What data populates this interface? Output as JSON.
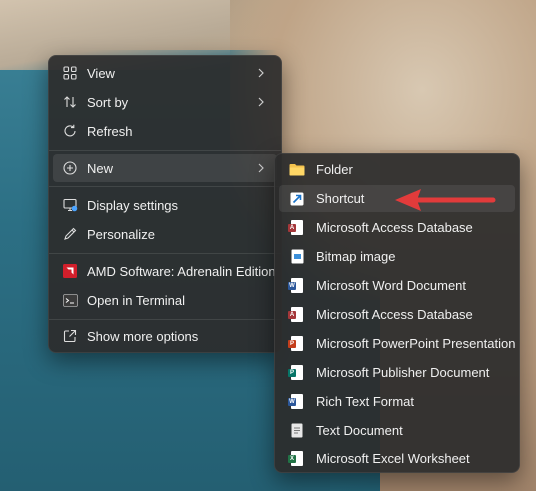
{
  "main_menu": {
    "items": [
      {
        "label": "View",
        "icon": "grid-icon",
        "submenu": true
      },
      {
        "label": "Sort by",
        "icon": "sort-icon",
        "submenu": true
      },
      {
        "label": "Refresh",
        "icon": "refresh-icon",
        "submenu": false
      },
      {
        "label": "New",
        "icon": "add-circle-icon",
        "submenu": true
      },
      {
        "label": "Display settings",
        "icon": "display-icon",
        "submenu": false
      },
      {
        "label": "Personalize",
        "icon": "pen-icon",
        "submenu": false
      },
      {
        "label": "AMD Software: Adrenalin Edition",
        "icon": "amd-icon",
        "submenu": false
      },
      {
        "label": "Open in Terminal",
        "icon": "terminal-icon",
        "submenu": false
      },
      {
        "label": "Show more options",
        "icon": "share-icon",
        "submenu": false
      }
    ]
  },
  "new_submenu": {
    "items": [
      {
        "label": "Folder",
        "icon": "folder-icon"
      },
      {
        "label": "Shortcut",
        "icon": "shortcut-icon"
      },
      {
        "label": "Microsoft Access Database",
        "icon": "access-icon"
      },
      {
        "label": "Bitmap image",
        "icon": "bitmap-icon"
      },
      {
        "label": "Microsoft Word Document",
        "icon": "word-icon"
      },
      {
        "label": "Microsoft Access Database",
        "icon": "access-icon"
      },
      {
        "label": "Microsoft PowerPoint Presentation",
        "icon": "powerpoint-icon"
      },
      {
        "label": "Microsoft Publisher Document",
        "icon": "publisher-icon"
      },
      {
        "label": "Rich Text Format",
        "icon": "word-icon"
      },
      {
        "label": "Text Document",
        "icon": "text-document-icon"
      },
      {
        "label": "Microsoft Excel Worksheet",
        "icon": "excel-icon"
      }
    ]
  },
  "colors": {
    "annotation_arrow": "#e23b3b",
    "word": "#2b579a",
    "access": "#a4373a",
    "powerpoint": "#c43e1c",
    "publisher": "#077568",
    "excel": "#217346",
    "folder": "#f4c24d"
  }
}
